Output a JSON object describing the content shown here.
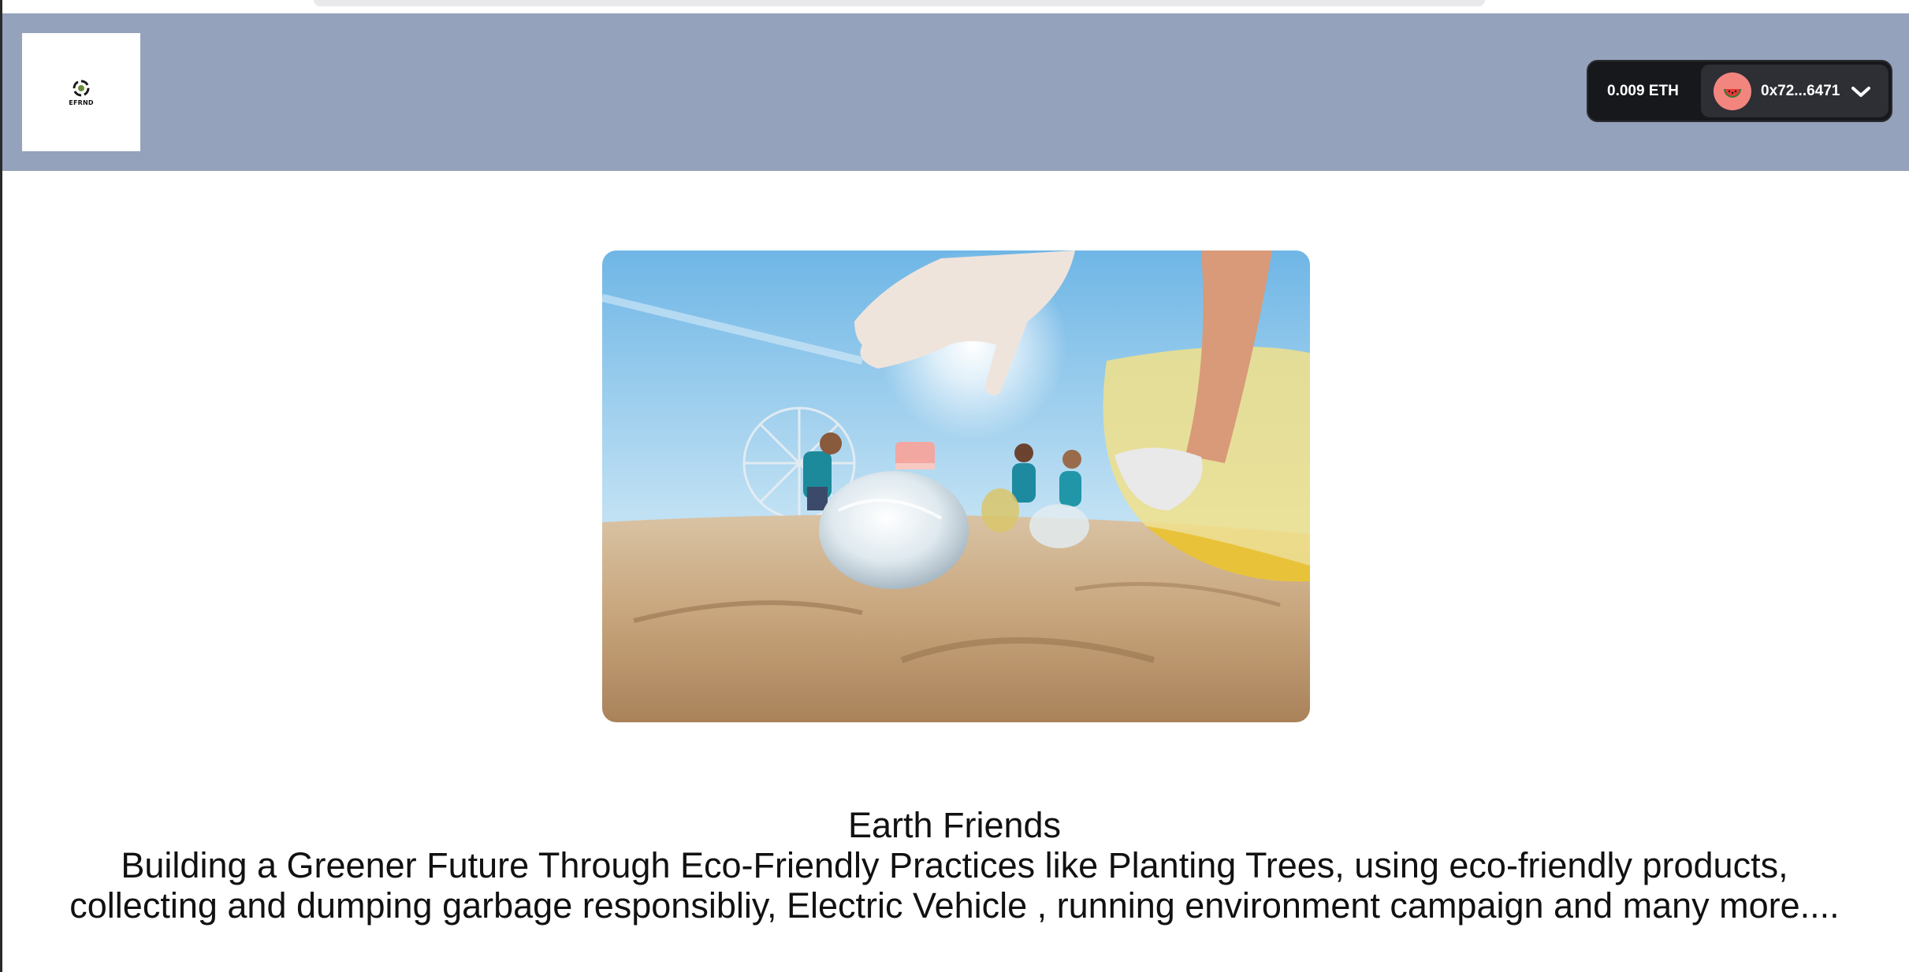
{
  "header": {
    "logo_text": "EFRND",
    "wallet": {
      "balance": "0.009 ETH",
      "address": "0x72...6471",
      "avatar_icon": "watermelon-icon",
      "dropdown_icon": "chevron-down-icon"
    }
  },
  "hero": {
    "image_subject": "volunteers picking up a plastic bottle on a sunny beach with a ferris wheel in the background"
  },
  "main": {
    "title": "Earth Friends",
    "description": "Building a Greener Future Through Eco-Friendly Practices like Planting Trees, using eco-friendly products, collecting and dumping garbage responsibliy, Electric Vehicle , running environment campaign and many more...."
  },
  "colors": {
    "navbar": "#94a3bb",
    "wallet_bg": "#17181c",
    "account_bg": "#2e2f35",
    "avatar": "#f3857f",
    "text": "#111111"
  }
}
